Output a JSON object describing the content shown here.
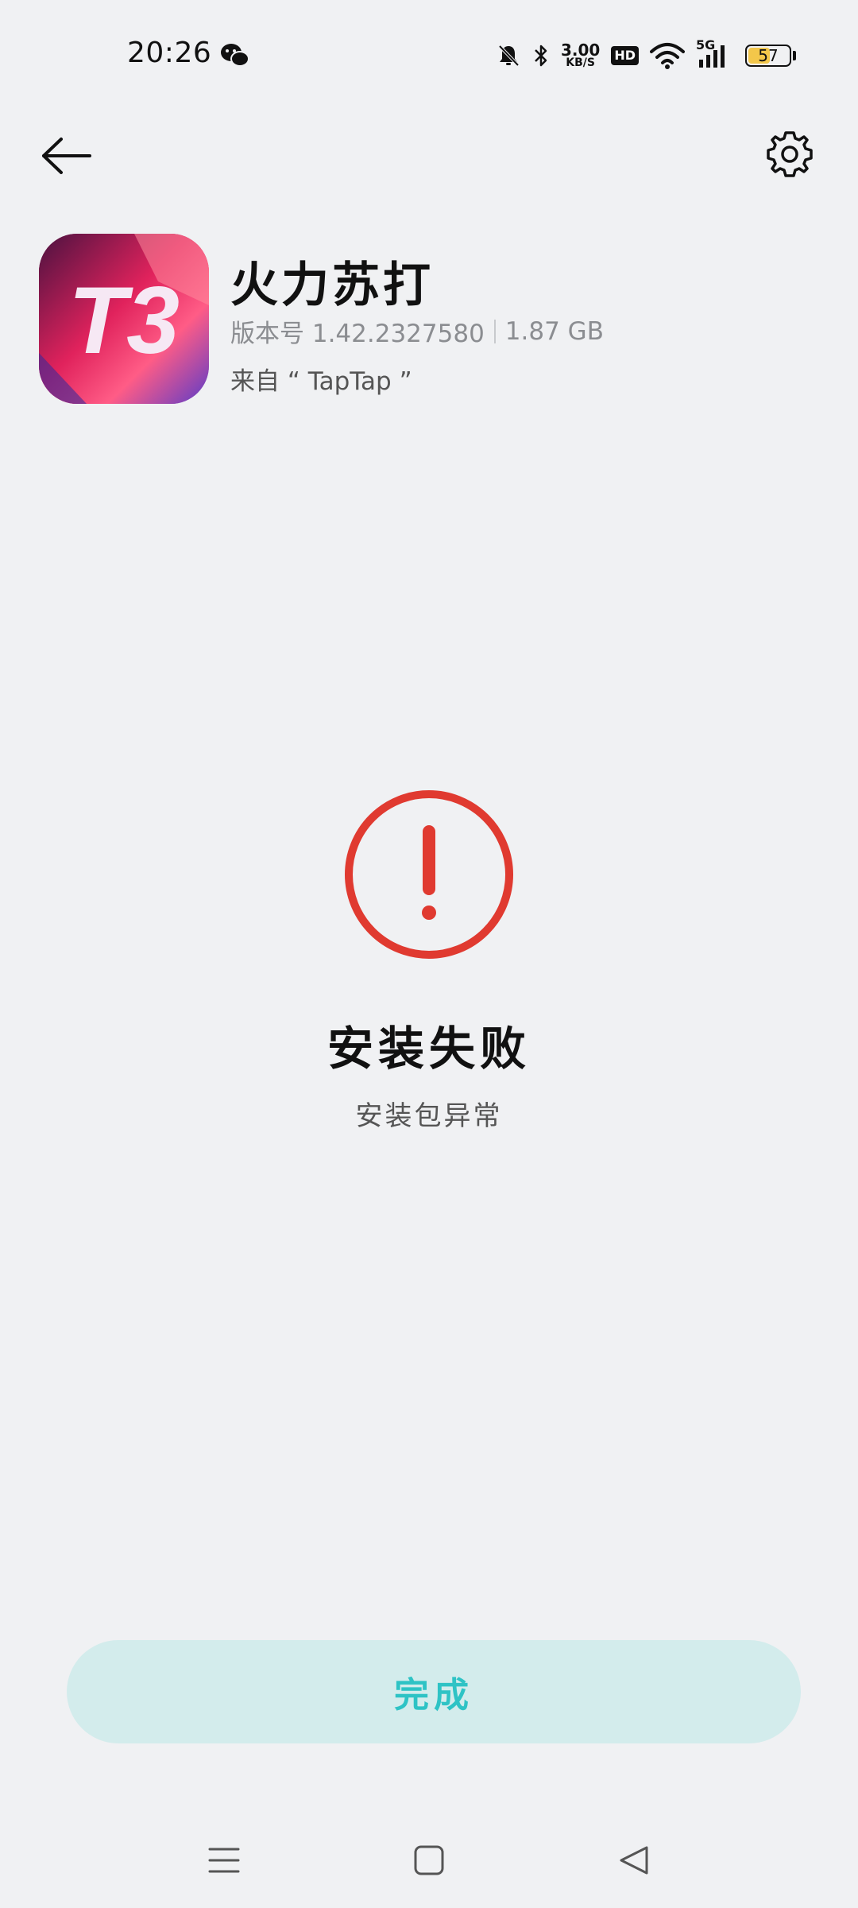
{
  "status_bar": {
    "time": "20:26",
    "net_speed_value": "3.00",
    "net_speed_unit": "KB/S",
    "hd_label": "HD",
    "signal_label": "5G",
    "battery_level": "57",
    "battery_percent": 57,
    "battery_color": "#f3c74a"
  },
  "header": {
    "back_icon": "arrow-left-icon",
    "settings_icon": "gear-icon"
  },
  "app": {
    "name": "火力苏打",
    "version_text": "版本号 1.42.2327580",
    "size_text": "1.87 GB",
    "source_text": "来自 “ TapTap ”",
    "icon_text": "T3"
  },
  "result": {
    "icon": "exclamation-circle-icon",
    "icon_color": "#e03a30",
    "title": "安装失败",
    "reason": "安装包异常"
  },
  "actions": {
    "done_label": "完成",
    "accent_color": "#2ec3c5"
  },
  "nav_bar": {
    "menu_icon": "menu-icon",
    "home_icon": "home-square-icon",
    "back_icon": "back-triangle-icon"
  }
}
